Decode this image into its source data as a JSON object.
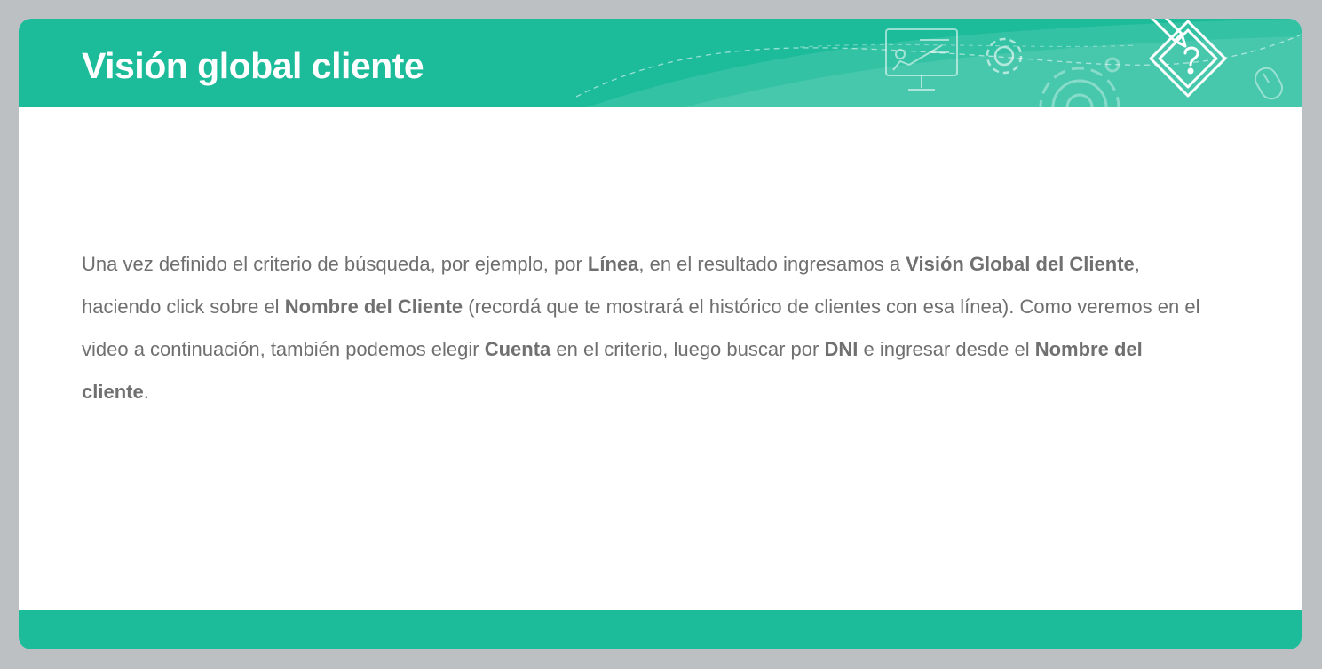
{
  "slide": {
    "title": "Visión global cliente",
    "colors": {
      "background": "#bdc0c3",
      "accent": "#1cbb9a",
      "text": "#6f6f6f"
    },
    "header_icons": [
      "presentation-board-icon",
      "gear-icon",
      "large-gear-icon",
      "mouse-icon",
      "pencil-question-badge-icon"
    ],
    "paragraph": {
      "t1": "Una vez definido el criterio de búsqueda, por ejemplo, por ",
      "b1": "Línea",
      "t2": ", en el resultado ingresamos a ",
      "b2": "Visión Global del Cliente",
      "t3": ", haciendo click sobre el ",
      "b3": "Nombre del Cliente",
      "t4": " (recordá que te mostrará el histórico de clientes con esa línea). Como veremos en el video a continuación, también podemos elegir ",
      "b4": "Cuenta",
      "t5": " en el criterio, luego buscar por ",
      "b5": "DNI",
      "t6": " e ingresar desde el ",
      "b6": "Nombre del cliente",
      "t7": "."
    }
  }
}
